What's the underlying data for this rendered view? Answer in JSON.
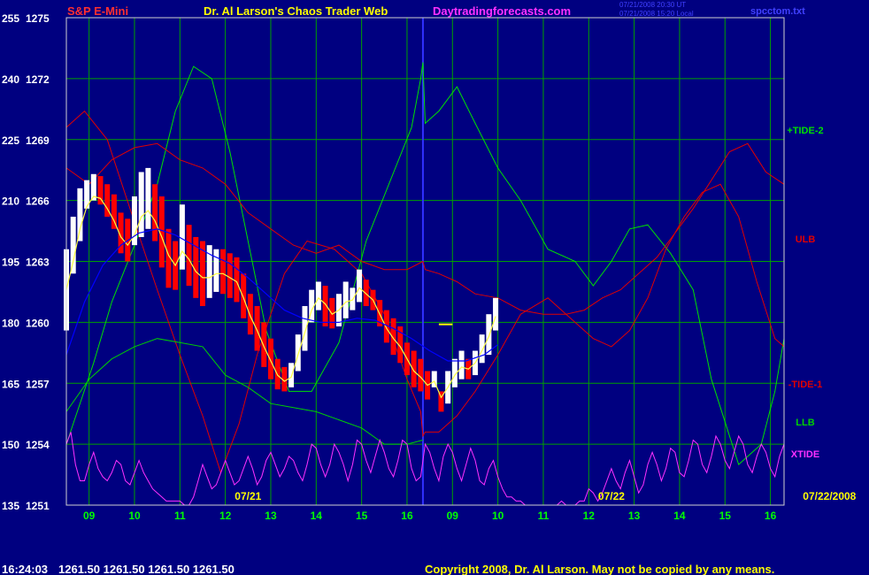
{
  "header": {
    "title_left": "S&P E-Mini",
    "title_center": "Dr. Al Larson's Chaos Trader Web",
    "site": "Daytradingforecasts.com",
    "stamp_line1": "07/21/2008 20:30 UT",
    "stamp_line2": "07/21/2008 15:20 Local",
    "file_name": "spcctom.txt"
  },
  "footer": {
    "time": "16:24:03",
    "quote": "1261.50 1261.50 1261.50 1261.50",
    "copyright": "Copyright 2008, Dr. Al Larson. May not be copied by any means."
  },
  "colors": {
    "background": "#000080",
    "grid": "#00a000",
    "border": "#d0d0d0",
    "axis_text": "#ffffff",
    "hour_text": "#00ff00",
    "day_label": "#ffff00",
    "title": "#ff3030",
    "title_center": "#ffff00",
    "site": "#ff30ff",
    "stamp": "#4040ff",
    "file_name": "#4040ff",
    "footer": "#ffffff",
    "copyright": "#ffff00",
    "divider": "#3030ff",
    "up_bar": "#ffffff",
    "down_bar": "#ff0000",
    "moving_average": "#ffff40",
    "slow_average": "#0000ff",
    "tide_plus": "#00e000",
    "tide_minus": "#e00000",
    "ulb": "#e00000",
    "llb": "#00d000",
    "xtide": "#ff30ff"
  },
  "chart_data": {
    "type": "line",
    "title": "S&P E-Mini",
    "y_left_ticks": [
      "255",
      "240",
      "225",
      "210",
      "195",
      "180",
      "165",
      "150",
      "135"
    ],
    "y_right_ticks": [
      "1275",
      "1272",
      "1269",
      "1266",
      "1263",
      "1260",
      "1257",
      "1254",
      "1251"
    ],
    "ylim_index": [
      135,
      255
    ],
    "ylim_price": [
      1251,
      1275
    ],
    "x_hour_ticks": [
      "09",
      "10",
      "11",
      "12",
      "13",
      "14",
      "15",
      "16",
      "09",
      "10",
      "11",
      "12",
      "13",
      "14",
      "15",
      "16"
    ],
    "x_hour_index": [
      0.5,
      1.5,
      2.5,
      3.5,
      4.5,
      5.5,
      6.5,
      7.5,
      8.5,
      9.5,
      10.5,
      11.5,
      12.5,
      13.5,
      14.5,
      15.5
    ],
    "xlim": [
      0,
      15.8
    ],
    "day_labels": [
      {
        "text": "07/21",
        "x": 4.0
      },
      {
        "text": "07/22",
        "x": 12.0
      },
      {
        "text": "07/22/2008",
        "x": 16.8
      }
    ],
    "session_divider_x": 7.85,
    "forecast_marker": {
      "x": [
        8.2,
        8.5
      ],
      "price": 1259.9
    },
    "grid": true,
    "series_labels": [
      "+TIDE-2",
      "ULB",
      "-TIDE-1",
      "LLB",
      "XTIDE"
    ],
    "price_bars": [
      [
        0.0,
        1263.6,
        1259.6
      ],
      [
        0.15,
        1265.2,
        1262.4
      ],
      [
        0.3,
        1266.6,
        1264.0
      ],
      [
        0.45,
        1267.0,
        1265.6
      ],
      [
        0.6,
        1267.3,
        1266.0
      ],
      [
        0.75,
        1267.2,
        1265.8
      ],
      [
        0.9,
        1266.8,
        1265.2
      ],
      [
        1.05,
        1266.3,
        1264.6
      ],
      [
        1.2,
        1265.4,
        1263.4
      ],
      [
        1.35,
        1265.1,
        1263.0
      ],
      [
        1.5,
        1266.2,
        1263.8
      ],
      [
        1.65,
        1267.4,
        1264.2
      ],
      [
        1.8,
        1267.6,
        1264.6
      ],
      [
        1.95,
        1266.8,
        1264.0
      ],
      [
        2.1,
        1266.2,
        1262.7
      ],
      [
        2.25,
        1264.6,
        1261.7
      ],
      [
        2.4,
        1264.0,
        1261.6
      ],
      [
        2.55,
        1265.8,
        1262.6
      ],
      [
        2.7,
        1264.8,
        1261.8
      ],
      [
        2.85,
        1264.2,
        1261.2
      ],
      [
        3.0,
        1264.0,
        1260.8
      ],
      [
        3.15,
        1263.8,
        1261.2
      ],
      [
        3.3,
        1263.6,
        1261.5
      ],
      [
        3.45,
        1263.6,
        1261.4
      ],
      [
        3.6,
        1263.4,
        1261.2
      ],
      [
        3.75,
        1263.2,
        1261.0
      ],
      [
        3.9,
        1262.4,
        1260.2
      ],
      [
        4.05,
        1261.4,
        1259.4
      ],
      [
        4.2,
        1260.8,
        1258.6
      ],
      [
        4.35,
        1260.0,
        1257.8
      ],
      [
        4.5,
        1259.2,
        1257.2
      ],
      [
        4.65,
        1258.2,
        1256.7
      ],
      [
        4.8,
        1257.8,
        1256.6
      ],
      [
        4.95,
        1258.0,
        1256.8
      ],
      [
        5.1,
        1259.4,
        1257.6
      ],
      [
        5.25,
        1260.8,
        1258.6
      ],
      [
        5.4,
        1261.6,
        1260.0
      ],
      [
        5.55,
        1262.0,
        1260.6
      ],
      [
        5.7,
        1261.8,
        1259.8
      ],
      [
        5.85,
        1261.2,
        1259.7
      ],
      [
        6.0,
        1261.4,
        1259.8
      ],
      [
        6.15,
        1262.0,
        1260.2
      ],
      [
        6.3,
        1261.7,
        1260.6
      ],
      [
        6.45,
        1262.6,
        1261.0
      ],
      [
        6.6,
        1262.1,
        1260.8
      ],
      [
        6.75,
        1261.6,
        1260.6
      ],
      [
        6.9,
        1261.1,
        1259.8
      ],
      [
        7.05,
        1260.6,
        1259.0
      ],
      [
        7.2,
        1260.2,
        1258.4
      ],
      [
        7.35,
        1259.8,
        1258.0
      ],
      [
        7.5,
        1259.0,
        1257.4
      ],
      [
        7.65,
        1258.6,
        1256.8
      ],
      [
        7.8,
        1258.2,
        1256.6
      ],
      [
        7.95,
        1257.6,
        1256.2
      ],
      [
        8.1,
        1257.6,
        1256.8
      ],
      [
        8.25,
        1256.6,
        1255.6
      ],
      [
        8.4,
        1257.6,
        1256.0
      ],
      [
        8.55,
        1258.2,
        1256.8
      ],
      [
        8.7,
        1258.6,
        1257.2
      ],
      [
        8.85,
        1258.2,
        1257.2
      ],
      [
        9.0,
        1258.6,
        1257.4
      ],
      [
        9.15,
        1259.4,
        1258.0
      ],
      [
        9.3,
        1260.4,
        1258.4
      ],
      [
        9.45,
        1261.2,
        1259.6
      ]
    ],
    "series": [
      {
        "name": "+TIDE-2",
        "color": "#00e000",
        "x": [
          0,
          0.6,
          1.0,
          1.5,
          2.0,
          2.4,
          2.8,
          3.2,
          3.6,
          4.0,
          4.4,
          4.9,
          5.4,
          6.0,
          6.6,
          7.1,
          7.6,
          7.8,
          7.85,
          7.9,
          8.2,
          8.6,
          9.0,
          9.5,
          10.0,
          10.6,
          11.2,
          11.6,
          12.0,
          12.4,
          12.8,
          13.3,
          13.8,
          14.2,
          14.8,
          15.3,
          15.6,
          15.8
        ],
        "y": [
          150,
          170,
          185,
          199,
          214,
          232,
          243,
          240,
          222,
          200,
          178,
          163,
          163,
          175,
          200,
          214,
          228,
          240,
          244,
          229,
          232,
          238,
          229,
          218,
          210,
          198,
          195,
          189,
          195,
          203,
          204,
          197,
          188,
          166,
          145,
          150,
          163,
          176
        ]
      },
      {
        "name": "ULB",
        "color": "#e00000",
        "x": [
          0,
          0.5,
          1.0,
          1.5,
          2.0,
          2.5,
          3.0,
          3.5,
          4.0,
          4.5,
          5.0,
          5.5,
          6.0,
          6.5,
          7.0,
          7.5,
          7.85,
          7.9,
          8.2,
          8.6,
          9.0,
          9.5,
          10.0,
          10.5,
          11.0,
          11.4,
          11.8,
          12.2,
          12.6,
          13.0,
          13.4,
          13.8,
          14.2,
          14.6,
          15.0,
          15.4,
          15.8
        ],
        "y": [
          218,
          214,
          220,
          223,
          224,
          220,
          218,
          214,
          207,
          203,
          199,
          197,
          199,
          195,
          193,
          193,
          195,
          193,
          192,
          190,
          187,
          186,
          183,
          182,
          182,
          183,
          186,
          188,
          192,
          196,
          202,
          208,
          215,
          222,
          224,
          217,
          214
        ]
      },
      {
        "name": "-TIDE-1",
        "color": "#e00000",
        "x": [
          0,
          0.4,
          0.9,
          1.4,
          2.0,
          2.5,
          3.0,
          3.4,
          3.8,
          4.2,
          4.8,
          5.3,
          5.9,
          6.5,
          7.0,
          7.5,
          7.8,
          7.85,
          7.9,
          8.2,
          8.6,
          9.0,
          9.5,
          10.0,
          10.6,
          11.2,
          11.6,
          12.0,
          12.4,
          12.8,
          13.2,
          13.6,
          14.0,
          14.4,
          14.8,
          15.2,
          15.6,
          15.8
        ],
        "y": [
          228,
          232,
          225,
          208,
          188,
          172,
          157,
          143,
          155,
          172,
          192,
          200,
          198,
          192,
          182,
          166,
          158,
          152,
          153,
          153,
          157,
          163,
          172,
          182,
          186,
          180,
          176,
          174,
          178,
          186,
          198,
          206,
          212,
          214,
          206,
          190,
          176,
          174
        ]
      },
      {
        "name": "LLB",
        "color": "#00d000",
        "x": [
          0,
          0.5,
          1.0,
          1.5,
          2.0,
          2.5,
          3.0,
          3.5,
          4.0,
          4.5,
          5.0,
          5.5,
          6.0,
          6.5,
          7.0,
          7.5,
          7.85
        ],
        "y": [
          158,
          166,
          171,
          174,
          176,
          175,
          174,
          167,
          164,
          160,
          159,
          158,
          156,
          154,
          150,
          150,
          151
        ]
      },
      {
        "name": "XTIDE",
        "color": "#ff30ff",
        "x": [
          0,
          0.1,
          0.2,
          0.3,
          0.4,
          0.5,
          0.6,
          0.7,
          0.8,
          0.9,
          1.0,
          1.1,
          1.2,
          1.3,
          1.4,
          1.5,
          1.6,
          1.7,
          1.8,
          1.9,
          2.0,
          2.1,
          2.2,
          2.3,
          2.4,
          2.5,
          2.6,
          2.7,
          2.8,
          2.9,
          3.0,
          3.1,
          3.2,
          3.3,
          3.4,
          3.5,
          3.6,
          3.7,
          3.8,
          3.9,
          4.0,
          4.1,
          4.2,
          4.3,
          4.4,
          4.5,
          4.6,
          4.7,
          4.8,
          4.9,
          5.0,
          5.1,
          5.2,
          5.3,
          5.4,
          5.5,
          5.6,
          5.7,
          5.8,
          5.9,
          6.0,
          6.1,
          6.2,
          6.3,
          6.4,
          6.5,
          6.6,
          6.7,
          6.8,
          6.9,
          7.0,
          7.1,
          7.2,
          7.3,
          7.4,
          7.5,
          7.6,
          7.7,
          7.8,
          7.9,
          8.0,
          8.1,
          8.2,
          8.3,
          8.4,
          8.5,
          8.6,
          8.7,
          8.8,
          8.9,
          9.0,
          9.1,
          9.2,
          9.3,
          9.4,
          9.5,
          9.6,
          9.7,
          9.8,
          9.9,
          10.0,
          10.1,
          10.2,
          10.3,
          10.4,
          10.5,
          10.6,
          10.7,
          10.8,
          10.9,
          11.0,
          11.1,
          11.2,
          11.3,
          11.4,
          11.5,
          11.6,
          11.7,
          11.8,
          11.9,
          12.0,
          12.1,
          12.2,
          12.3,
          12.4,
          12.5,
          12.6,
          12.7,
          12.8,
          12.9,
          13.0,
          13.1,
          13.2,
          13.3,
          13.4,
          13.5,
          13.6,
          13.7,
          13.8,
          13.9,
          14.0,
          14.1,
          14.2,
          14.3,
          14.4,
          14.5,
          14.6,
          14.7,
          14.8,
          14.9,
          15.0,
          15.1,
          15.2,
          15.3,
          15.4,
          15.5,
          15.6,
          15.7,
          15.8
        ],
        "y": [
          150,
          153,
          145,
          141,
          141,
          145,
          148,
          144,
          142,
          141,
          143,
          146,
          145,
          141,
          140,
          143,
          146,
          143,
          141,
          139,
          138,
          137,
          136,
          136,
          136,
          136,
          135,
          135,
          137,
          141,
          145,
          142,
          139,
          140,
          143,
          146,
          143,
          140,
          141,
          144,
          147,
          144,
          140,
          142,
          146,
          148,
          145,
          142,
          144,
          147,
          146,
          143,
          141,
          145,
          150,
          149,
          145,
          142,
          145,
          150,
          148,
          145,
          141,
          145,
          151,
          150,
          146,
          143,
          147,
          151,
          148,
          144,
          142,
          146,
          151,
          150,
          144,
          141,
          142,
          150,
          148,
          144,
          141,
          147,
          150,
          148,
          144,
          141,
          145,
          149,
          146,
          141,
          140,
          144,
          146,
          142,
          139,
          137,
          137,
          136,
          136,
          135,
          135,
          135,
          135,
          135,
          135,
          135,
          135,
          136,
          135,
          135,
          135,
          136,
          136,
          139,
          138,
          136,
          138,
          141,
          144,
          141,
          139,
          143,
          146,
          142,
          138,
          140,
          145,
          148,
          145,
          141,
          144,
          149,
          148,
          143,
          142,
          146,
          151,
          150,
          145,
          143,
          147,
          152,
          150,
          146,
          144,
          148,
          152,
          150,
          145,
          143,
          147,
          150,
          148,
          144,
          142,
          147,
          150
        ]
      },
      {
        "name": "fast-average",
        "color": "#ffff40",
        "x": [
          0.0,
          0.15,
          0.3,
          0.45,
          0.6,
          0.75,
          0.9,
          1.05,
          1.2,
          1.35,
          1.5,
          1.65,
          1.8,
          1.95,
          2.1,
          2.25,
          2.4,
          2.55,
          2.7,
          2.85,
          3.0,
          3.15,
          3.3,
          3.45,
          3.6,
          3.75,
          3.9,
          4.05,
          4.2,
          4.35,
          4.5,
          4.65,
          4.8,
          4.95,
          5.1,
          5.25,
          5.4,
          5.55,
          5.7,
          5.85,
          6.0,
          6.15,
          6.3,
          6.45,
          6.6,
          6.75,
          6.9,
          7.05,
          7.2,
          7.35,
          7.5,
          7.65,
          7.8,
          7.95,
          8.1,
          8.25,
          8.4,
          8.55,
          8.7,
          8.85,
          9.0,
          9.15,
          9.3,
          9.45
        ],
        "y": [
          1261.6,
          1263.0,
          1264.6,
          1265.7,
          1266.2,
          1266.1,
          1265.6,
          1265.0,
          1264.2,
          1263.8,
          1264.3,
          1265.2,
          1265.5,
          1265.0,
          1264.2,
          1263.3,
          1262.8,
          1263.5,
          1263.1,
          1262.5,
          1262.2,
          1262.2,
          1262.4,
          1262.4,
          1262.2,
          1262.0,
          1261.2,
          1260.3,
          1259.6,
          1258.8,
          1258.1,
          1257.4,
          1257.1,
          1257.3,
          1258.4,
          1259.5,
          1260.6,
          1261.2,
          1260.9,
          1260.4,
          1260.6,
          1261.0,
          1261.1,
          1261.7,
          1261.4,
          1261.1,
          1260.4,
          1259.7,
          1259.2,
          1258.8,
          1258.2,
          1257.6,
          1257.3,
          1256.9,
          1257.1,
          1256.3,
          1256.8,
          1257.4,
          1257.8,
          1257.7,
          1258.0,
          1258.6,
          1259.3,
          1260.3
        ]
      },
      {
        "name": "slow-average",
        "color": "#0000ff",
        "x": [
          0,
          0.4,
          0.8,
          1.2,
          1.6,
          2.0,
          2.4,
          2.8,
          3.2,
          3.6,
          4.0,
          4.4,
          4.8,
          5.2,
          5.6,
          6.0,
          6.4,
          6.8,
          7.2,
          7.6,
          8.0,
          8.4,
          8.8,
          9.2,
          9.5
        ],
        "y": [
          1258.4,
          1261.0,
          1262.8,
          1263.8,
          1264.4,
          1264.6,
          1264.3,
          1263.8,
          1263.3,
          1262.9,
          1262.2,
          1261.4,
          1260.6,
          1260.2,
          1260.0,
          1260.0,
          1260.2,
          1260.1,
          1259.7,
          1259.2,
          1258.6,
          1258.1,
          1258.1,
          1258.4,
          1258.9
        ]
      }
    ]
  }
}
